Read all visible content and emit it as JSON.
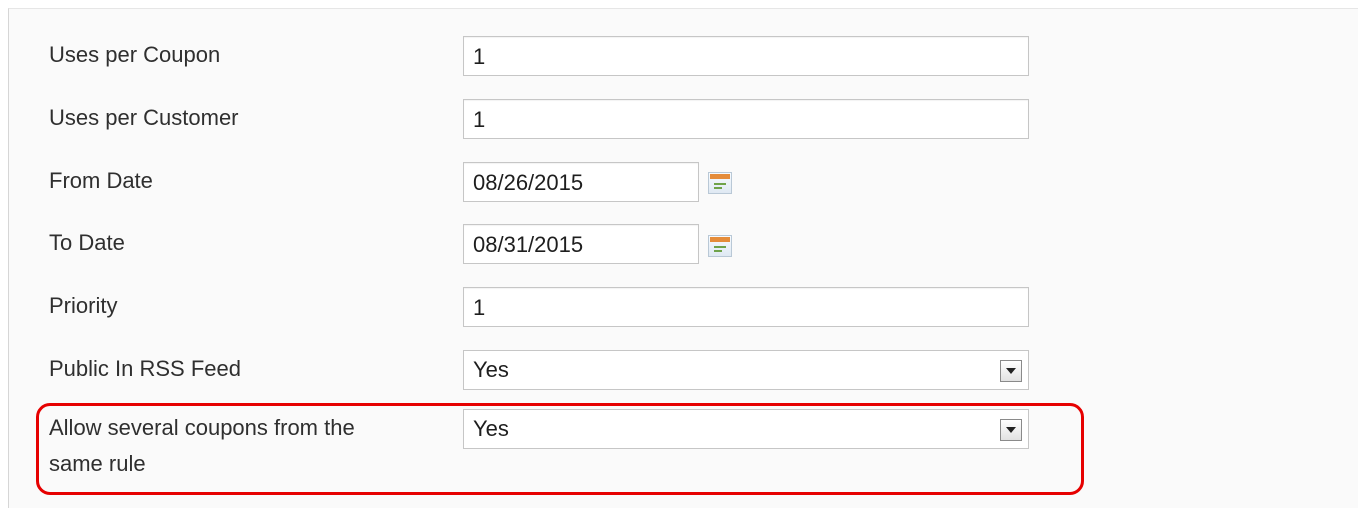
{
  "form": {
    "uses_per_coupon": {
      "label": "Uses per Coupon",
      "value": "1"
    },
    "uses_per_customer": {
      "label": "Uses per Customer",
      "value": "1"
    },
    "from_date": {
      "label": "From Date",
      "value": "08/26/2015",
      "icon": "calendar-icon"
    },
    "to_date": {
      "label": "To Date",
      "value": "08/31/2015",
      "icon": "calendar-icon"
    },
    "priority": {
      "label": "Priority",
      "value": "1"
    },
    "public_rss": {
      "label": "Public In RSS Feed",
      "value": "Yes",
      "icon": "chevron-down-icon"
    },
    "allow_several": {
      "label_line1": "Allow several coupons from the",
      "label_line2": "same rule",
      "value": "Yes",
      "icon": "chevron-down-icon"
    }
  },
  "colors": {
    "highlight": "#e60000",
    "label_text": "#2f2f2f",
    "field_border": "#c6c6c6"
  }
}
